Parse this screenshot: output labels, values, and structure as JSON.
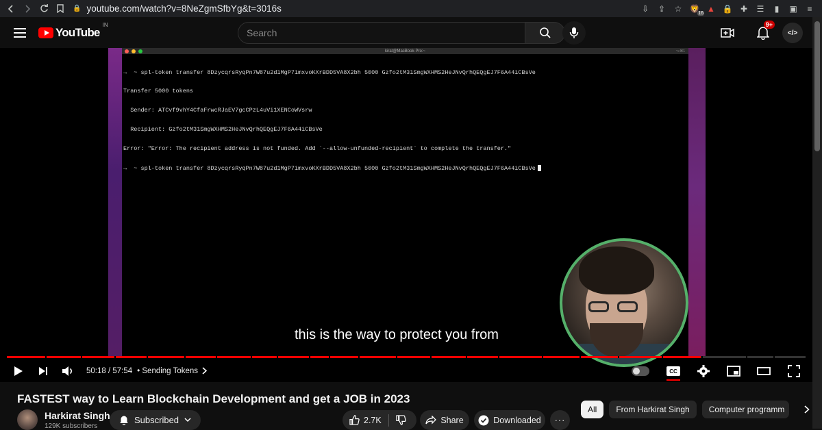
{
  "browser": {
    "url": "youtube.com/watch?v=8NeZgmSfbYg&t=3016s",
    "brave_badge": "16"
  },
  "header": {
    "logo_text": "YouTube",
    "country_code": "IN",
    "search_placeholder": "Search",
    "notification_count": "9+",
    "avatar_text": "</>"
  },
  "player": {
    "terminal_title": "kirat@MacBook-Pro:~",
    "terminal_shortcut": "⌥⌘1",
    "terminal_lines": [
      "→  ~ spl-token transfer 8DzycqrsRyqPn7W87u2d1MgP7imxvoKXrBDD5VA8X2bh 5000 Gzfo2tM31SmgWXHMS2HeJNvQrhQEQgEJ7F6A44iCBsVe",
      "Transfer 5000 tokens",
      "  Sender: ATCvf9vhY4CfaFrwcRJaEV7gcCPzL4uVi1XENCoWVsrw",
      "  Recipient: Gzfo2tM31SmgWXHMS2HeJNvQrhQEQgEJ7F6A44iCBsVe",
      "Error: \"Error: The recipient address is not funded. Add `--allow-unfunded-recipient` to complete the transfer.\"",
      "→  ~ spl-token transfer 8DzycqrsRyqPn7W87u2d1MgP7imxvoKXrBDD5VA8X2bh 5000 Gzfo2tM31SmgWXHMS2HeJNvQrhQEQgEJ7F6A44iCBsVe"
    ],
    "caption": "this is the way to protect you from",
    "time": "50:18 / 57:54",
    "chapter": "• Sending Tokens",
    "progress_played_fraction": 0.869,
    "cc_label": "CC"
  },
  "video": {
    "title": "FASTEST way to Learn Blockchain Development and get a JOB in 2023",
    "channel_name": "Harkirat Singh",
    "subscribers": "129K subscribers",
    "subscribe_label": "Subscribed",
    "like_count": "2.7K",
    "share_label": "Share",
    "download_label": "Downloaded",
    "more_label": "···"
  },
  "chips": [
    "All",
    "From Harkirat Singh",
    "Computer programm"
  ]
}
